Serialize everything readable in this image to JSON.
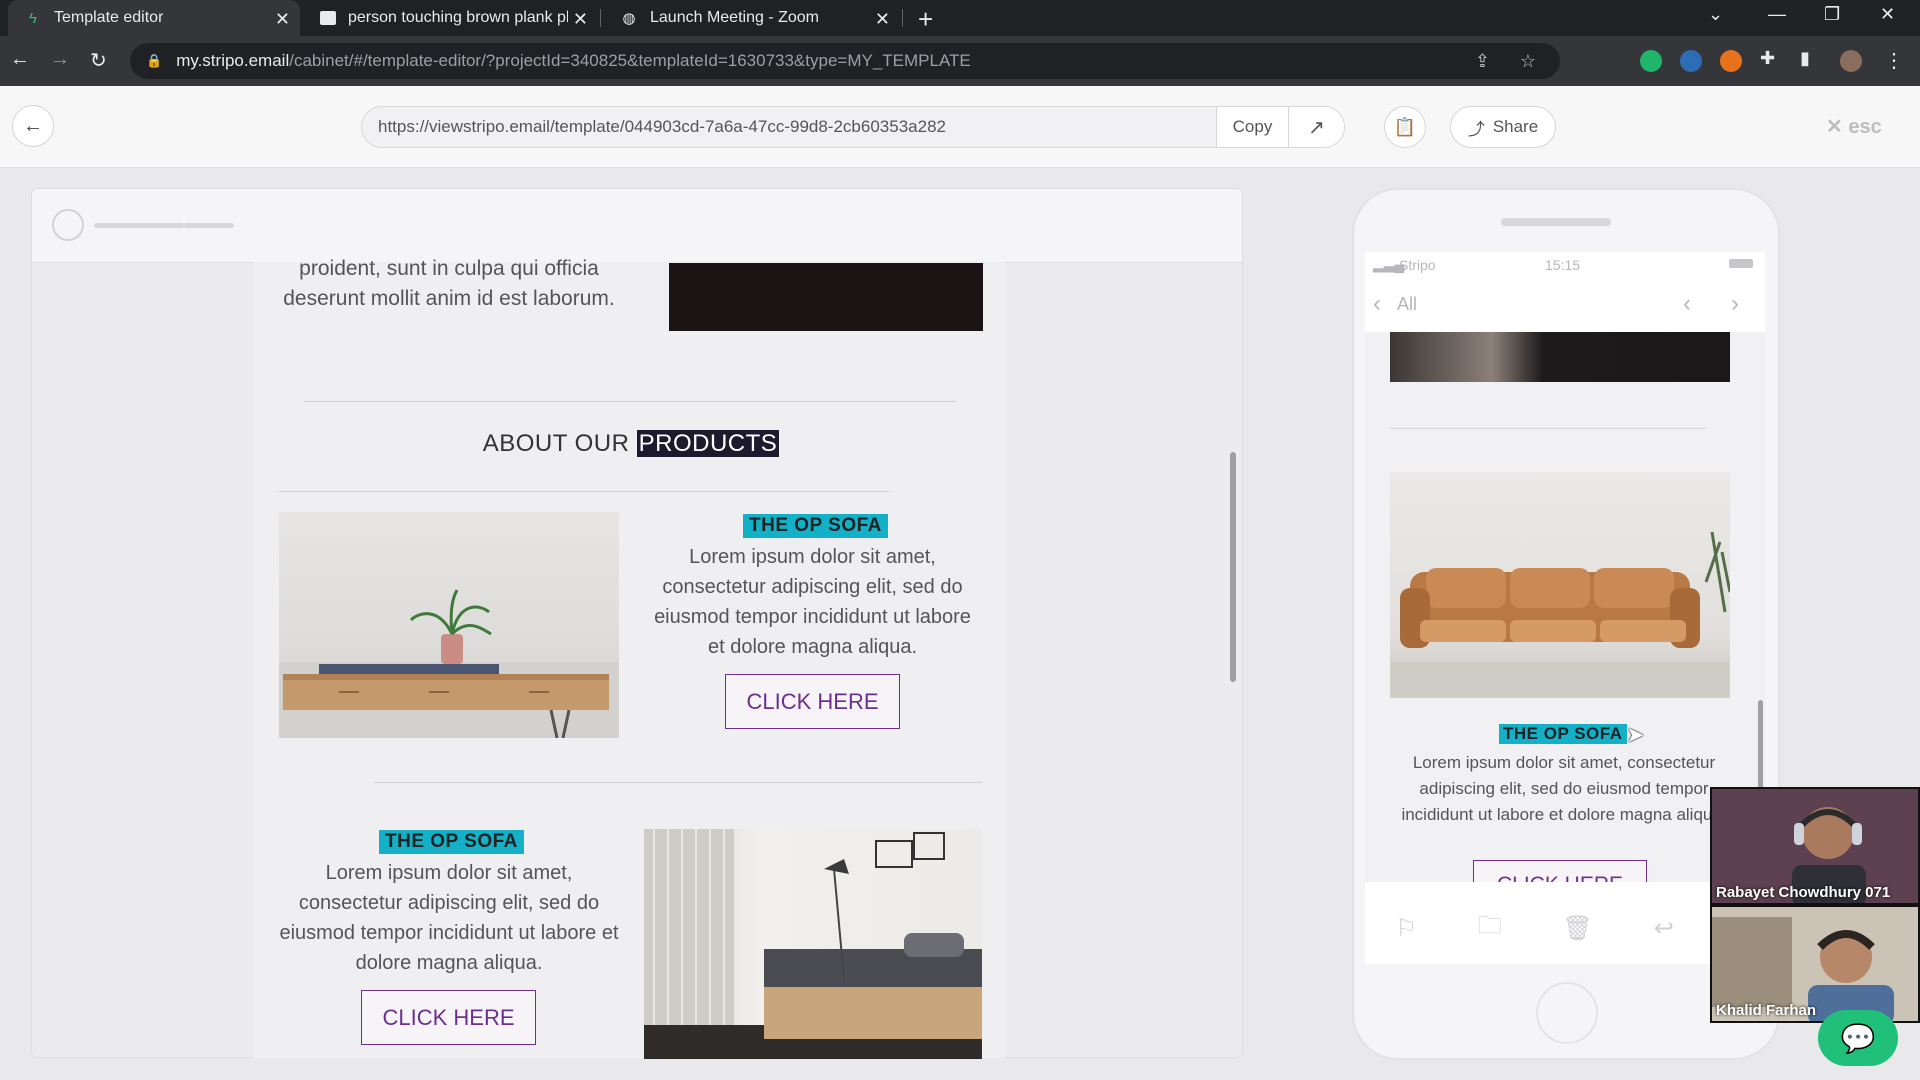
{
  "browser": {
    "tabs": [
      {
        "title": "Template editor",
        "icon": "stripo-icon"
      },
      {
        "title": "person touching brown plank ph",
        "icon": "unsplash-icon"
      },
      {
        "title": "Launch Meeting - Zoom",
        "icon": "globe-icon"
      }
    ],
    "url_host": "my.stripo.email",
    "url_path": "/cabinet/#/template-editor/?projectId=340825&templateId=1630733&type=MY_TEMPLATE"
  },
  "toolbar": {
    "share_link": "https://viewstripo.email/template/044903cd-7a6a-47cc-99d8-2cb60353a282",
    "copy_label": "Copy",
    "share_label": "Share",
    "esc_label": "esc"
  },
  "desktop": {
    "intro_text": "proident, sunt in culpa qui officia deserunt mollit anim id est laborum.",
    "section_title_prefix": "ABOUT OUR",
    "section_title_highlight": "PRODUCTS",
    "product1": {
      "tag": "THE OP SOFA",
      "text": "Lorem ipsum dolor sit amet, consectetur adipiscing elit, sed do eiusmod tempor incididunt ut labore et dolore magna aliqua.",
      "cta": "CLICK HERE"
    },
    "product2": {
      "tag": "THE OP SOFA",
      "text": "Lorem ipsum dolor sit amet, consectetur adipiscing elit, sed do eiusmod tempor incididunt ut labore et dolore magna aliqua.",
      "cta": "CLICK HERE"
    }
  },
  "mobile": {
    "carrier": "Stripo",
    "time": "15:15",
    "back_label": "All",
    "product": {
      "tag": "THE OP SOFA",
      "text": "Lorem ipsum dolor sit amet, consectetur adipiscing elit, sed do eiusmod tempor incididunt ut labore et dolore magna aliqua.",
      "cta": "CLICK HERE"
    }
  },
  "zoom": {
    "participants": [
      {
        "name": "Rabayet Chowdhury 071"
      },
      {
        "name": "Khalid Farhan"
      }
    ]
  },
  "colors": {
    "accent_teal": "#13b0c7",
    "cta_purple": "#6d2f8f",
    "zoom_green": "#21c07a"
  }
}
